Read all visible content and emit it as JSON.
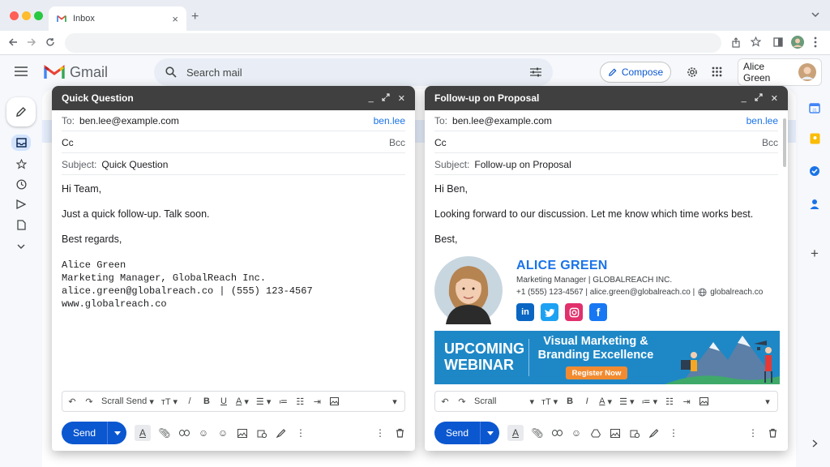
{
  "browser": {
    "tab_title": "Inbox",
    "tab_close": "×",
    "new_tab": "+"
  },
  "gmail": {
    "logo_text": "Gmail",
    "search_placeholder": "Search mail",
    "compose_label": "Compose",
    "user_name": "Alice Green"
  },
  "compose_left": {
    "title": "Quick Question",
    "to_label": "To:",
    "to_value": "ben.lee@example.com",
    "to_link": "ben.lee",
    "cc_label": "Cc",
    "bcc_label": "Bcc",
    "subject_label": "Subject:",
    "subject_value": "Quick Question",
    "greeting": "Hi Team,",
    "body": "Just a quick follow-up. Talk soon.",
    "closing": "Best regards,",
    "sig_lines": [
      "Alice Green",
      "Marketing Manager, GlobalReach Inc.",
      "alice.green@globalreach.co | (555) 123-4567",
      "www.globalreach.co"
    ],
    "font_select": "Scrall Send",
    "send_label": "Send"
  },
  "compose_right": {
    "title": "Follow-up on Proposal",
    "to_label": "To:",
    "to_value": "ben.lee@example.com",
    "to_link": "ben.lee",
    "cc_label": "Cc",
    "bcc_label": "Bcc",
    "subject_label": "Subject:",
    "subject_value": "Follow-up on Proposal",
    "greeting": "Hi Ben,",
    "body": "Looking forward to our discussion. Let me know which time works best.",
    "closing": "Best,",
    "signature": {
      "name": "ALICE GREEN",
      "title": "Marketing Manager | GLOBALREACH INC.",
      "contact": "+1 (555) 123-4567 | alice.green@globalreach.co |",
      "website": "globalreach.co"
    },
    "banner": {
      "left_line1": "UPCOMING",
      "left_line2": "WEBINAR",
      "headline1": "Visual Marketing &",
      "headline2": "Branding Excellence",
      "cta": "Register Now"
    },
    "font_select": "Scrall",
    "send_label": "Send"
  },
  "colors": {
    "accent": "#0b57d0",
    "header_dark": "#404040",
    "banner": "#1e88c7",
    "cta": "#f28b30",
    "linkedin": "#0a66c2",
    "twitter": "#1da1f2",
    "instagram": "#e1306c",
    "facebook": "#1877f2"
  }
}
